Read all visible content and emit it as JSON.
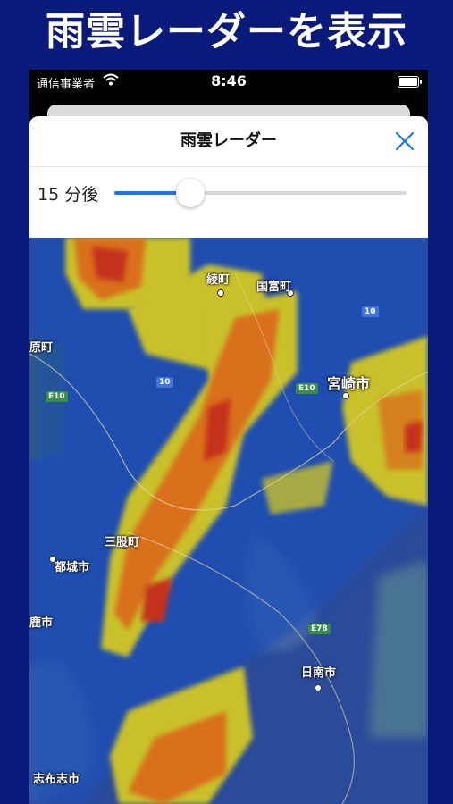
{
  "promo": {
    "title": "雨雲レーダーを表示"
  },
  "status_bar": {
    "carrier": "通信事業者",
    "time": "8:46"
  },
  "sheet": {
    "title": "雨雲レーダー"
  },
  "slider": {
    "label": "15 分後",
    "value": 0.26
  },
  "map": {
    "places": [
      {
        "name": "綾町"
      },
      {
        "name": "国富町"
      },
      {
        "name": "宮崎市"
      },
      {
        "name": "三股町"
      },
      {
        "name": "都城市"
      },
      {
        "name": "日南市"
      },
      {
        "name": "志布志市"
      },
      {
        "name": "原町"
      },
      {
        "name": "鹿市"
      }
    ],
    "routes": [
      {
        "label": "10"
      },
      {
        "label": "10"
      },
      {
        "label": "E10"
      },
      {
        "label": "E10"
      },
      {
        "label": "E78"
      }
    ]
  },
  "colors": {
    "background": "#0a1a7a",
    "accent": "#1677f0",
    "rain_light": "#1e4fb8",
    "rain_moderate": "#c9c12c",
    "rain_heavy": "#d9701c",
    "rain_intense": "#c4301e"
  },
  "icons": {
    "close": "close-icon",
    "wifi": "wifi-icon",
    "battery": "battery-icon"
  }
}
